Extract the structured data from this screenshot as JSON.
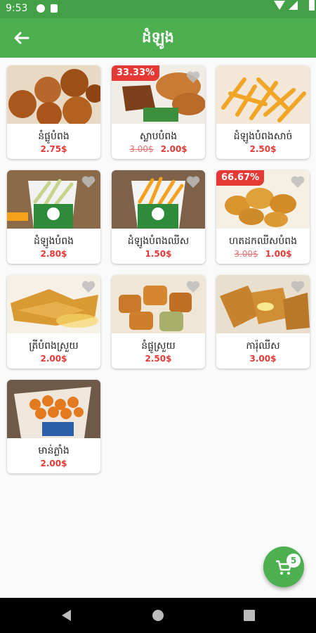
{
  "status": {
    "time": "9:53"
  },
  "appbar": {
    "title": "ដំឡូង",
    "back_icon": "arrow-left-icon"
  },
  "colors": {
    "primary": "#4caf50",
    "accent": "#e53935"
  },
  "products": [
    {
      "name": "នំផ្លូបំពង",
      "price": "2.75$",
      "old_price": "",
      "discount": ""
    },
    {
      "name": "ស្លាបបំពង",
      "price": "2.00$",
      "old_price": "3.00$",
      "discount": "33.33%"
    },
    {
      "name": "ដំឡូងបំពងសាច់",
      "price": "2.50$",
      "old_price": "",
      "discount": ""
    },
    {
      "name": "ដំឡូងបំពង",
      "price": "2.80$",
      "old_price": "",
      "discount": ""
    },
    {
      "name": "ដំឡូងបំពងឈីស",
      "price": "1.50$",
      "old_price": "",
      "discount": ""
    },
    {
      "name": "ហតដកឈីសបំពង",
      "price": "1.00$",
      "old_price": "3.00$",
      "discount": "66.67%"
    },
    {
      "name": "ត្រីបំពងស្រួយ",
      "price": "2.00$",
      "old_price": "",
      "discount": ""
    },
    {
      "name": "នំផ្លូស្រួយ",
      "price": "2.50$",
      "old_price": "",
      "discount": ""
    },
    {
      "name": "ការ៉ុឈីស",
      "price": "3.00$",
      "old_price": "",
      "discount": ""
    },
    {
      "name": "មាន់ភ្លាំង",
      "price": "2.00$",
      "old_price": "",
      "discount": ""
    }
  ],
  "cart": {
    "count": "5",
    "icon": "cart-icon"
  }
}
